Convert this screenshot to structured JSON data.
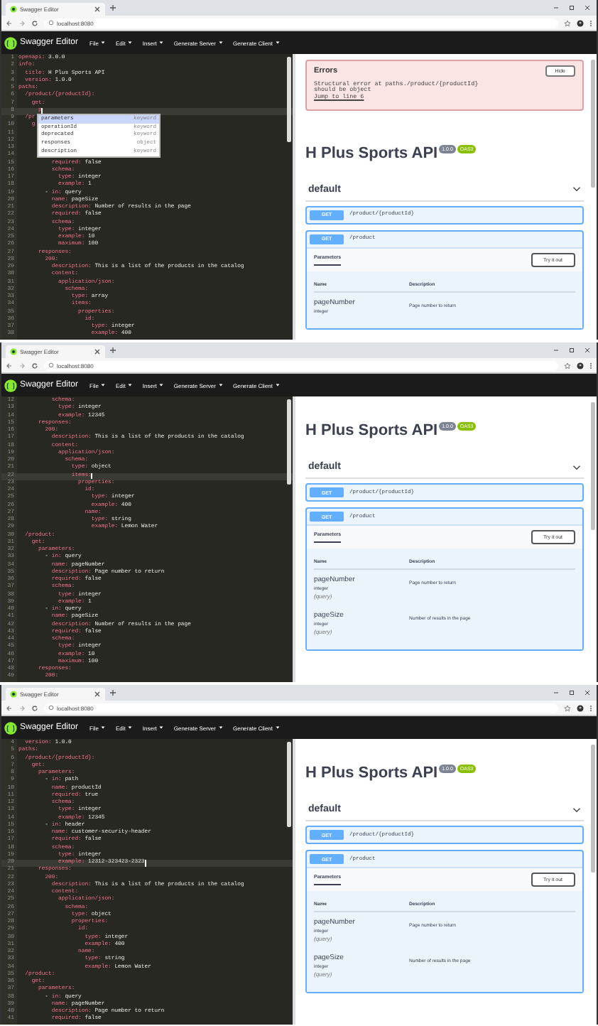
{
  "frames": [
    {
      "browser": {
        "tab_title": "Swagger Editor",
        "address": "localhost:8080"
      },
      "editor_header": {
        "logo": "Swagger Editor",
        "menu": [
          "File",
          "Edit",
          "Insert",
          "Generate Server",
          "Generate Client"
        ]
      },
      "editor": {
        "lines": [
          {
            "n": "1",
            "text": "openapi: 3.0.0",
            "current": false
          },
          {
            "n": "2",
            "text": "info:",
            "current": false
          },
          {
            "n": "3",
            "text": "  title: H Plus Sports API",
            "current": false
          },
          {
            "n": "4",
            "text": "  version: 1.0.0",
            "current": false
          },
          {
            "n": "5",
            "text": "paths:",
            "current": false
          },
          {
            "n": "6",
            "text": "  /product/{productId}:",
            "current": false
          },
          {
            "n": "7",
            "text": "    get:",
            "current": false
          },
          {
            "n": "8",
            "text": "      p",
            "current": true
          },
          {
            "n": "9",
            "text": "  /pr",
            "current": false
          },
          {
            "n": "10",
            "text": "    g",
            "current": false
          },
          {
            "n": "11",
            "current": false
          },
          {
            "n": "12",
            "current": false
          },
          {
            "n": "13",
            "current": false
          },
          {
            "n": "14",
            "current": false
          },
          {
            "n": "15",
            "text": "          required: false",
            "current": false
          },
          {
            "n": "16",
            "text": "          schema:",
            "current": false
          },
          {
            "n": "17",
            "text": "            type: integer",
            "current": false
          },
          {
            "n": "18",
            "text": "            example: 1",
            "current": false
          },
          {
            "n": "19",
            "text": "        - in: query",
            "current": false
          },
          {
            "n": "20",
            "text": "          name: pageSize",
            "current": false
          },
          {
            "n": "21",
            "text": "          description: Number of results in the page",
            "current": false
          },
          {
            "n": "22",
            "text": "          required: false",
            "current": false
          },
          {
            "n": "23",
            "text": "          schema:",
            "current": false
          },
          {
            "n": "24",
            "text": "            type: integer",
            "current": false
          },
          {
            "n": "25",
            "text": "            example: 10",
            "current": false
          },
          {
            "n": "26",
            "text": "            maximum: 100",
            "current": false
          },
          {
            "n": "27",
            "text": "      responses:",
            "current": false
          },
          {
            "n": "28",
            "text": "        200:",
            "current": false
          },
          {
            "n": "29",
            "text": "          description: This is a list of the products in the catalog",
            "current": false
          },
          {
            "n": "30",
            "text": "          content:",
            "current": false
          },
          {
            "n": "31",
            "text": "            application/json:",
            "current": false
          },
          {
            "n": "32",
            "text": "              schema:",
            "current": false
          },
          {
            "n": "33",
            "text": "                type: array",
            "current": false
          },
          {
            "n": "34",
            "text": "                items:",
            "current": false
          },
          {
            "n": "35",
            "text": "                  properties:",
            "current": false
          },
          {
            "n": "36",
            "text": "                    id:",
            "current": false
          },
          {
            "n": "37",
            "text": "                      type: integer",
            "current": false
          },
          {
            "n": "38",
            "text": "                      example: 400",
            "current": false
          }
        ],
        "autocomplete": [
          {
            "label": "parameters",
            "type": "keyword",
            "selected": true
          },
          {
            "label": "operationId",
            "type": "keyword",
            "selected": false
          },
          {
            "label": "deprecated",
            "type": "keyword",
            "selected": false
          },
          {
            "label": "responses",
            "type": "object",
            "selected": false
          },
          {
            "label": "description",
            "type": "keyword",
            "selected": false
          }
        ]
      },
      "preview": {
        "errors": {
          "title": "Errors",
          "button": "Hide",
          "lines": [
            "Structural error at paths./product/{productId}",
            "should be object"
          ],
          "link": "Jump to line 6"
        },
        "api": {
          "title": "H Plus Sports API",
          "version": "1.0.0",
          "spec": "OAS3"
        },
        "section": {
          "name": "default",
          "expanded": true
        },
        "operations": [
          {
            "method": "GET",
            "path": "/product/{productId}",
            "expanded": false
          },
          {
            "method": "GET",
            "path": "/product",
            "expanded": true,
            "tab": "Parameters",
            "button": "Try it out",
            "columns": [
              "Name",
              "Description"
            ],
            "parameters": [
              {
                "name": "pageNumber",
                "type": "integer",
                "description": "Page number to return"
              }
            ]
          }
        ]
      }
    },
    {
      "browser": {
        "tab_title": "Swagger Editor",
        "address": "localhost:8080"
      },
      "editor_header": {
        "logo": "Swagger Editor",
        "menu": [
          "File",
          "Edit",
          "Insert",
          "Generate Server",
          "Generate Client"
        ]
      },
      "editor": {
        "lines": [
          {
            "n": "12",
            "text": "          schema:",
            "current": false
          },
          {
            "n": "13",
            "text": "            type: integer",
            "current": false
          },
          {
            "n": "14",
            "text": "            example: 12345",
            "current": false
          },
          {
            "n": "15",
            "text": "      responses:",
            "current": false
          },
          {
            "n": "16",
            "text": "        200:",
            "current": false
          },
          {
            "n": "17",
            "text": "          description: This is a list of the products in the catalog",
            "current": false
          },
          {
            "n": "18",
            "text": "          content:",
            "current": false
          },
          {
            "n": "19",
            "text": "            application/json:",
            "current": false
          },
          {
            "n": "20",
            "text": "              schema:",
            "current": false
          },
          {
            "n": "21",
            "text": "                type: object",
            "current": false
          },
          {
            "n": "22",
            "text": "                items:",
            "current": true
          },
          {
            "n": "23",
            "text": "                  properties:",
            "current": false
          },
          {
            "n": "24",
            "text": "                    id:",
            "current": false
          },
          {
            "n": "25",
            "text": "                      type: integer",
            "current": false
          },
          {
            "n": "26",
            "text": "                      example: 400",
            "current": false
          },
          {
            "n": "27",
            "text": "                    name:",
            "current": false
          },
          {
            "n": "28",
            "text": "                      type: string",
            "current": false
          },
          {
            "n": "29",
            "text": "                      example: Lemon Water",
            "current": false
          },
          {
            "n": "30",
            "text": "  /product:",
            "current": false
          },
          {
            "n": "31",
            "text": "    get:",
            "current": false
          },
          {
            "n": "32",
            "text": "      parameters:",
            "current": false
          },
          {
            "n": "33",
            "text": "        - in: query",
            "current": false
          },
          {
            "n": "34",
            "text": "          name: pageNumber",
            "current": false
          },
          {
            "n": "35",
            "text": "          description: Page number to return",
            "current": false
          },
          {
            "n": "36",
            "text": "          required: false",
            "current": false
          },
          {
            "n": "37",
            "text": "          schema:",
            "current": false
          },
          {
            "n": "38",
            "text": "            type: integer",
            "current": false
          },
          {
            "n": "39",
            "text": "            example: 1",
            "current": false
          },
          {
            "n": "40",
            "text": "        - in: query",
            "current": false
          },
          {
            "n": "41",
            "text": "          name: pageSize",
            "current": false
          },
          {
            "n": "42",
            "text": "          description: Number of results in the page",
            "current": false
          },
          {
            "n": "43",
            "text": "          required: false",
            "current": false
          },
          {
            "n": "44",
            "text": "          schema:",
            "current": false
          },
          {
            "n": "45",
            "text": "            type: integer",
            "current": false
          },
          {
            "n": "46",
            "text": "            example: 10",
            "current": false
          },
          {
            "n": "47",
            "text": "            maximum: 100",
            "current": false
          },
          {
            "n": "48",
            "text": "      responses:",
            "current": false
          },
          {
            "n": "49",
            "text": "        200:",
            "current": false
          }
        ]
      },
      "preview": {
        "api": {
          "title": "H Plus Sports API",
          "version": "1.0.0",
          "spec": "OAS3"
        },
        "section": {
          "name": "default",
          "expanded": true
        },
        "operations": [
          {
            "method": "GET",
            "path": "/product/{productId}",
            "expanded": false
          },
          {
            "method": "GET",
            "path": "/product",
            "expanded": true,
            "tab": "Parameters",
            "button": "Try it out",
            "columns": [
              "Name",
              "Description"
            ],
            "parameters": [
              {
                "name": "pageNumber",
                "type": "integer",
                "location": "(query)",
                "description": "Page number to return"
              },
              {
                "name": "pageSize",
                "type": "integer",
                "location": "(query)",
                "description": "Number of results in the page"
              }
            ]
          }
        ]
      }
    },
    {
      "browser": {
        "tab_title": "Swagger Editor",
        "address": "localhost:8080"
      },
      "editor_header": {
        "logo": "Swagger Editor",
        "menu": [
          "File",
          "Edit",
          "Insert",
          "Generate Server",
          "Generate Client"
        ]
      },
      "editor": {
        "lines": [
          {
            "n": "4",
            "text": "  version: 1.0.0",
            "current": false
          },
          {
            "n": "5",
            "text": "paths:",
            "current": false
          },
          {
            "n": "6",
            "text": "  /product/{productId}:",
            "current": false
          },
          {
            "n": "7",
            "text": "    get:",
            "current": false
          },
          {
            "n": "8",
            "text": "      parameters:",
            "current": false
          },
          {
            "n": "9",
            "text": "        - in: path",
            "current": false
          },
          {
            "n": "10",
            "text": "          name: productId",
            "current": false
          },
          {
            "n": "11",
            "text": "          required: true",
            "current": false
          },
          {
            "n": "12",
            "text": "          schema:",
            "current": false
          },
          {
            "n": "13",
            "text": "            type: integer",
            "current": false
          },
          {
            "n": "14",
            "text": "            example: 12345",
            "current": false
          },
          {
            "n": "15",
            "text": "        - in: header",
            "current": false
          },
          {
            "n": "16",
            "text": "          name: customer-security-header",
            "current": false
          },
          {
            "n": "17",
            "text": "          required: false",
            "current": false
          },
          {
            "n": "18",
            "text": "          schema:",
            "current": false
          },
          {
            "n": "19",
            "text": "            type: integer",
            "current": false
          },
          {
            "n": "20",
            "text": "            example: 12312-323423-2323",
            "current": true
          },
          {
            "n": "21",
            "text": "      responses:",
            "current": false
          },
          {
            "n": "22",
            "text": "        200:",
            "current": false
          },
          {
            "n": "23",
            "text": "          description: This is a list of the products in the catalog",
            "current": false
          },
          {
            "n": "24",
            "text": "          content:",
            "current": false
          },
          {
            "n": "25",
            "text": "            application/json:",
            "current": false
          },
          {
            "n": "26",
            "text": "              schema:",
            "current": false
          },
          {
            "n": "27",
            "text": "                type: object",
            "current": false
          },
          {
            "n": "28",
            "text": "                properties:",
            "current": false
          },
          {
            "n": "29",
            "text": "                  id:",
            "current": false
          },
          {
            "n": "30",
            "text": "                    type: integer",
            "current": false
          },
          {
            "n": "31",
            "text": "                    example: 400",
            "current": false
          },
          {
            "n": "32",
            "text": "                  name:",
            "current": false
          },
          {
            "n": "33",
            "text": "                    type: string",
            "current": false
          },
          {
            "n": "34",
            "text": "                    example: Lemon Water",
            "current": false
          },
          {
            "n": "35",
            "text": "  /product:",
            "current": false
          },
          {
            "n": "36",
            "text": "    get:",
            "current": false
          },
          {
            "n": "37",
            "text": "      parameters:",
            "current": false
          },
          {
            "n": "38",
            "text": "        - in: query",
            "current": false
          },
          {
            "n": "39",
            "text": "          name: pageNumber",
            "current": false
          },
          {
            "n": "40",
            "text": "          description: Page number to return",
            "current": false
          },
          {
            "n": "41",
            "text": "          required: false",
            "current": false
          }
        ]
      },
      "preview": {
        "api": {
          "title": "H Plus Sports API",
          "version": "1.0.0",
          "spec": "OAS3"
        },
        "section": {
          "name": "default",
          "expanded": true
        },
        "operations": [
          {
            "method": "GET",
            "path": "/product/{productId}",
            "expanded": false
          },
          {
            "method": "GET",
            "path": "/product",
            "expanded": true,
            "tab": "Parameters",
            "button": "Try it out",
            "columns": [
              "Name",
              "Description"
            ],
            "parameters": [
              {
                "name": "pageNumber",
                "type": "integer",
                "location": "(query)",
                "description": "Page number to return"
              },
              {
                "name": "pageSize",
                "type": "integer",
                "location": "(query)",
                "description": "Number of results in the page"
              }
            ]
          }
        ]
      }
    }
  ]
}
